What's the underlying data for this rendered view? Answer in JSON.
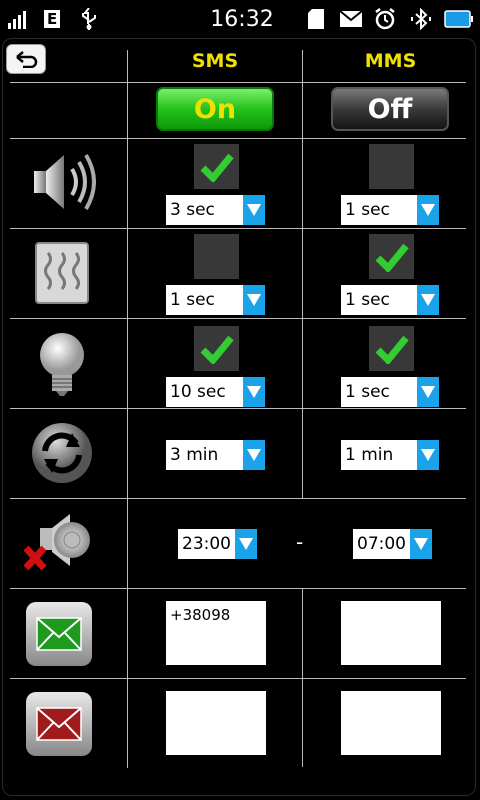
{
  "status_bar": {
    "time": "16:32",
    "network_letter": "E",
    "icons": [
      "signal-icon",
      "usb-icon",
      "sd-card-icon",
      "envelope-icon",
      "alarm-icon",
      "bluetooth-icon",
      "battery-icon"
    ]
  },
  "columns": {
    "sms": "SMS",
    "mms": "MMS"
  },
  "toggles": {
    "sms": "On",
    "mms": "Off"
  },
  "rows": {
    "sound": {
      "sms_checked": true,
      "sms_value": "3 sec",
      "mms_checked": false,
      "mms_value": "1 sec"
    },
    "vibration": {
      "sms_checked": false,
      "sms_value": "1 sec",
      "mms_checked": true,
      "mms_value": "1 sec"
    },
    "light": {
      "sms_checked": true,
      "sms_value": "10 sec",
      "mms_checked": true,
      "mms_value": "1 sec"
    },
    "repeat": {
      "sms_value": "3 min",
      "mms_value": "1 min"
    },
    "silent": {
      "from": "23:00",
      "separator": "-",
      "to": "07:00"
    },
    "whitelist": {
      "sms_value": "+38098",
      "mms_value": ""
    },
    "blacklist": {
      "sms_value": "",
      "mms_value": ""
    }
  },
  "colors": {
    "accent_yellow": "#f0e000",
    "on_green": "#23c21a",
    "dropdown_blue": "#1aa3e8",
    "check_green": "#33cc33"
  }
}
